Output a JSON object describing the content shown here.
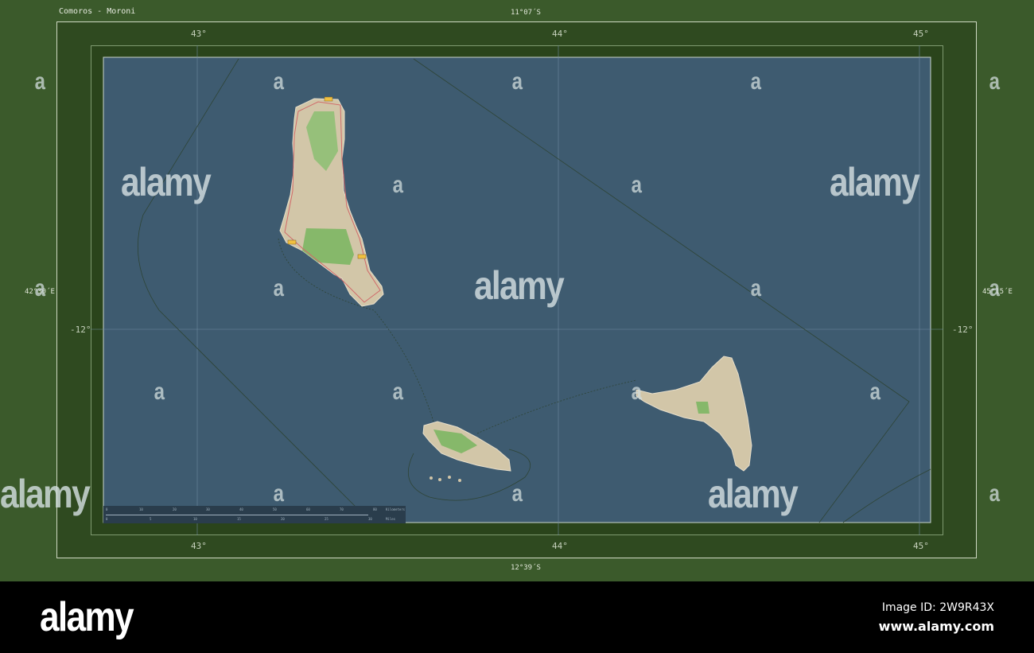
{
  "title": "Comoros - Moroni",
  "coords": {
    "top": "11°07´S",
    "bottom": "12°39´S",
    "left": "42°30´E",
    "right": "45°15´E"
  },
  "lon_ticks": [
    "43°",
    "44°",
    "45°"
  ],
  "lat_ticks": [
    "-12°"
  ],
  "scale_bar": {
    "km_labels": [
      "0",
      "10",
      "20",
      "30",
      "40",
      "50",
      "60",
      "70",
      "80"
    ],
    "km_unit": "Kilometers",
    "mi_labels": [
      "0",
      "5",
      "10",
      "15",
      "20",
      "25",
      "30"
    ],
    "mi_unit": "Miles"
  },
  "colors": {
    "ocean": "#3e5b70",
    "land": "#d2c6a8",
    "park": "#86b86a",
    "frame": "#3b5a2b"
  },
  "watermark": {
    "letter": "a",
    "word": "alamy"
  },
  "footer": {
    "logo": "alamy",
    "image_id": "Image ID: 2W9R43X",
    "site": "www.alamy.com"
  }
}
